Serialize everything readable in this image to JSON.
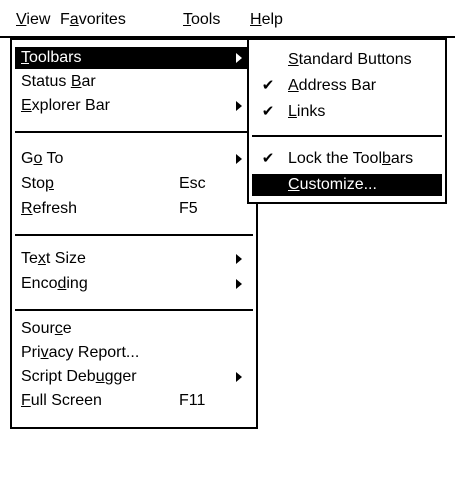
{
  "menubar": {
    "view": {
      "pre": "",
      "u": "V",
      "post": "iew"
    },
    "favorites": {
      "pre": "F",
      "u": "a",
      "post": "vorites"
    },
    "tools": {
      "pre": "",
      "u": "T",
      "post": "ools"
    },
    "help": {
      "pre": "",
      "u": "H",
      "post": "elp"
    }
  },
  "view_menu": {
    "toolbars": {
      "pre": "",
      "u": "T",
      "post": "oolbars"
    },
    "status_bar": {
      "pre": "Status ",
      "u": "B",
      "post": "ar"
    },
    "explorer_bar": {
      "pre": "",
      "u": "E",
      "post": "xplorer Bar"
    },
    "go_to": {
      "pre": "G",
      "u": "o",
      "post": " To"
    },
    "stop": {
      "pre": "Sto",
      "u": "p",
      "post": "",
      "shortcut": "Esc"
    },
    "refresh": {
      "pre": "",
      "u": "R",
      "post": "efresh",
      "shortcut": "F5"
    },
    "text_size": {
      "pre": "Te",
      "u": "x",
      "post": "t Size"
    },
    "encoding": {
      "pre": "Enco",
      "u": "d",
      "post": "ing"
    },
    "source": {
      "pre": "Sour",
      "u": "c",
      "post": "e"
    },
    "privacy_report": {
      "pre": "Pri",
      "u": "v",
      "post": "acy Report..."
    },
    "script_debugger": {
      "pre": "Script Deb",
      "u": "u",
      "post": "gger"
    },
    "full_screen": {
      "pre": "",
      "u": "F",
      "post": "ull Screen",
      "shortcut": "F11"
    }
  },
  "toolbars_submenu": {
    "check_glyph": "✔",
    "standard_buttons": {
      "pre": "",
      "u": "S",
      "post": "tandard Buttons",
      "checked": false
    },
    "address_bar": {
      "pre": "",
      "u": "A",
      "post": "ddress Bar",
      "checked": true
    },
    "links": {
      "pre": "",
      "u": "L",
      "post": "inks",
      "checked": true
    },
    "lock_toolbars": {
      "pre": "Lock the Tool",
      "u": "b",
      "post": "ars",
      "checked": true
    },
    "customize": {
      "pre": "",
      "u": "C",
      "post": "ustomize...",
      "checked": false
    }
  },
  "colors": {
    "highlight": "#000000",
    "highlight_text": "#ffffff",
    "background": "#ffffff"
  },
  "icons": {
    "submenu_arrow": "chevron-right-icon",
    "check": "checkmark-icon"
  }
}
